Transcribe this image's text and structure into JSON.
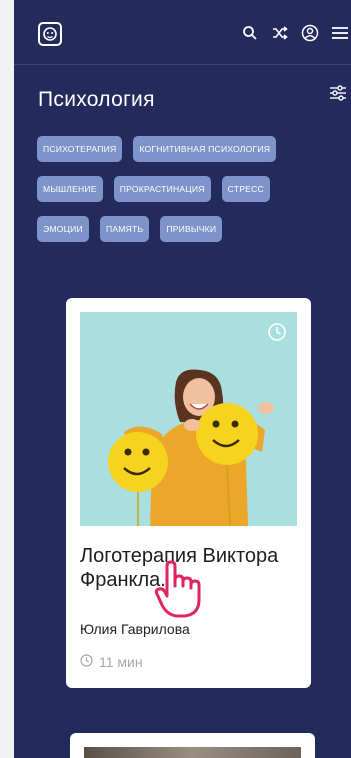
{
  "header": {
    "logo_icon": "monkey-logo-icon",
    "icons": [
      "search-icon",
      "shuffle-icon",
      "profile-icon",
      "menu-icon"
    ]
  },
  "category": {
    "title": "Психология",
    "filter_icon": "filter-sliders-icon"
  },
  "tags": [
    [
      "ПСИХОТЕРАПИЯ",
      "КОГНИТИВНАЯ ПСИХОЛОГИЯ"
    ],
    [
      "МЫШЛЕНИЕ",
      "ПРОКРАСТИНАЦИЯ",
      "СТРЕСС"
    ],
    [
      "ЭМОЦИИ",
      "ПАМЯТЬ",
      "ПРИВЫЧКИ"
    ]
  ],
  "article": {
    "title": "Логотерапия Виктора Франкла.",
    "author": "Юлия Гаврилова",
    "duration": "11 мин",
    "badge_icon": "clock-icon"
  },
  "colors": {
    "background": "#232a5c",
    "tag": "#7d93c9",
    "card": "#ffffff",
    "photo_bg": "#aadfe0",
    "balloon": "#f6d31e",
    "cursor": "#e0245e"
  }
}
